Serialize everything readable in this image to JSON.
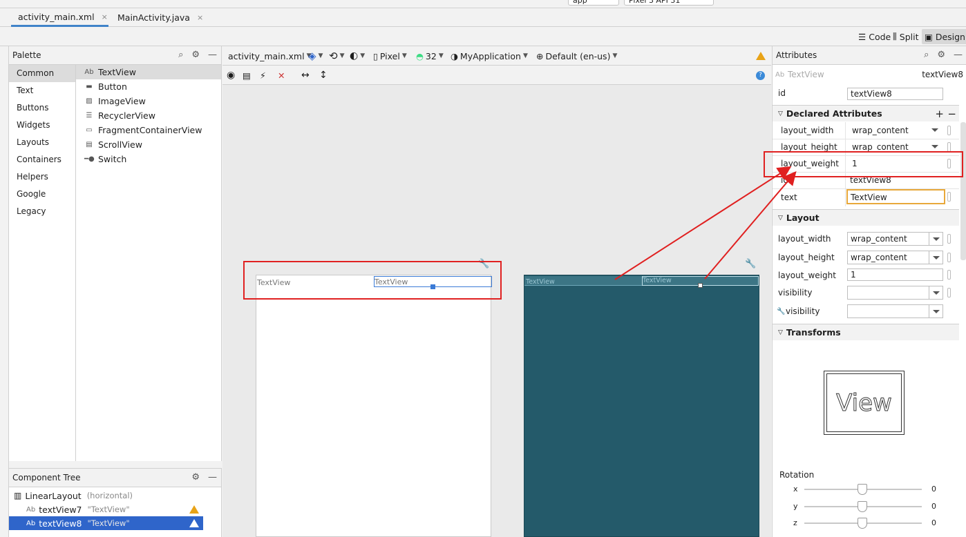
{
  "top": {
    "run_config": "app",
    "device": "Pixel 3 API 31"
  },
  "tabs": [
    {
      "label": "activity_main.xml",
      "close": "×"
    },
    {
      "label": "MainActivity.java",
      "close": "×"
    }
  ],
  "view_modes": {
    "code": "Code",
    "split": "Split",
    "design": "Design"
  },
  "palette": {
    "title": "Palette",
    "categories": [
      "Common",
      "Text",
      "Buttons",
      "Widgets",
      "Layouts",
      "Containers",
      "Helpers",
      "Google",
      "Legacy"
    ],
    "items": [
      {
        "label": "TextView",
        "icon": "Ab"
      },
      {
        "label": "Button",
        "icon": "button-icon"
      },
      {
        "label": "ImageView",
        "icon": "image-icon"
      },
      {
        "label": "RecyclerView",
        "icon": "list-icon"
      },
      {
        "label": "FragmentContainerView",
        "icon": "fragment-icon"
      },
      {
        "label": "ScrollView",
        "icon": "scroll-icon"
      },
      {
        "label": "Switch",
        "icon": "switch-icon"
      }
    ]
  },
  "tree": {
    "title": "Component Tree",
    "rows": [
      {
        "label": "LinearLayout",
        "sub": "(horizontal)"
      },
      {
        "label": "textView7",
        "sub": "\"TextView\""
      },
      {
        "label": "textView8",
        "sub": "\"TextView\""
      }
    ]
  },
  "canvas": {
    "file": "activity_main.xml",
    "device": "Pixel",
    "api": "32",
    "theme": "MyApplication",
    "locale": "Default (en-us)",
    "text_views": [
      "TextView",
      "TextView"
    ]
  },
  "attributes": {
    "title": "Attributes",
    "widget_type": "TextView",
    "widget_id": "textView8",
    "id_label": "id",
    "id_value": "textView8",
    "declared": {
      "title": "Declared Attributes",
      "rows": [
        {
          "label": "layout_width",
          "value": "wrap_content"
        },
        {
          "label": "layout_height",
          "value": "wrap_content"
        },
        {
          "label": "layout_weight",
          "value": "1"
        },
        {
          "label": "id",
          "value": "textView8"
        },
        {
          "label": "text",
          "value": "TextView"
        }
      ]
    },
    "layout": {
      "title": "Layout",
      "rows": [
        {
          "label": "layout_width",
          "value": "wrap_content"
        },
        {
          "label": "layout_height",
          "value": "wrap_content"
        },
        {
          "label": "layout_weight",
          "value": "1"
        },
        {
          "label": "visibility",
          "value": ""
        },
        {
          "label": "visibility",
          "value": ""
        }
      ]
    },
    "transforms": {
      "title": "Transforms",
      "preview": "View",
      "rotation_label": "Rotation",
      "axes": [
        {
          "label": "x",
          "value": "0"
        },
        {
          "label": "y",
          "value": "0"
        },
        {
          "label": "z",
          "value": "0"
        }
      ]
    }
  },
  "colors": {
    "accent": "#2f65ca",
    "annotation": "#e02020",
    "blueprint": "#245a6a",
    "warning": "#e8a317"
  }
}
